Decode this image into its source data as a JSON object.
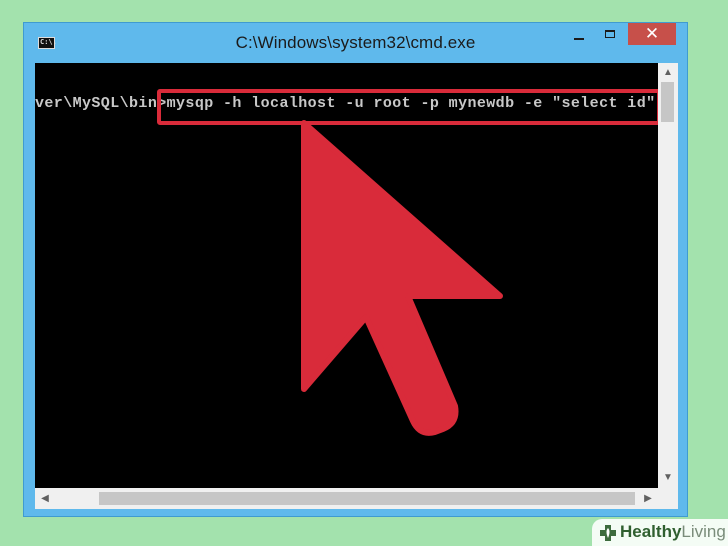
{
  "window": {
    "title": "C:\\Windows\\system32\\cmd.exe",
    "controls": {
      "minimize": "",
      "maximize": "",
      "close": "✕"
    },
    "title_color": "#1b1b1b",
    "frame_color": "#5fb9ec",
    "close_color": "#c7504a"
  },
  "console": {
    "line": "ver\\MySQL\\bin>mysqp -h localhost -u root -p mynewdb -e \"select id\"",
    "text_color": "#c8c8c8",
    "background": "#000000"
  },
  "annotation": {
    "highlight_color": "#d92b3a",
    "arrow_color": "#d92b3a",
    "arrow_icon": "cursor-arrow-icon"
  },
  "watermark": {
    "brand_a": "Healthy",
    "brand_b": "Living",
    "logo_icon": "healthy-living-logo-icon",
    "logo_color": "#3d6b3d"
  },
  "background_color": "#a3e2ad"
}
